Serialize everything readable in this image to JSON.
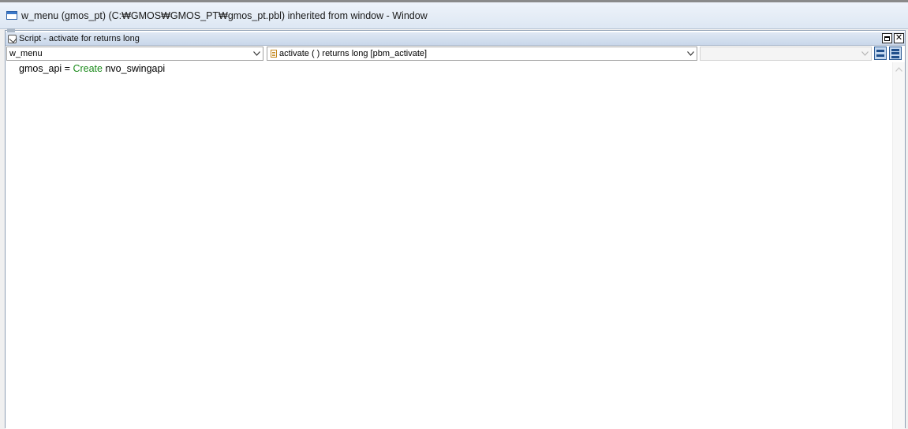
{
  "window": {
    "title": "w_menu (gmos_pt) (C:₩GMOS₩GMOS_PT₩gmos_pt.pbl) inherited from window - Window"
  },
  "script_panel": {
    "title": "Script - activate for  returns long",
    "object_combo": "w_menu",
    "event_combo": "activate ( )  returns long [pbm_activate]",
    "ancestor_combo": "",
    "buttons": {
      "maximize": "□",
      "close": "✕"
    }
  },
  "editor": {
    "lines": [
      {
        "pre": "gmos_api = ",
        "keyword": "Create",
        "post": " nvo_swingapi"
      }
    ]
  },
  "colors": {
    "keyword": "#1a8a1a",
    "title_bar": "#dde7f3",
    "script_bar": "#c9d7ea"
  },
  "icons": [
    "window-icon",
    "script-icon",
    "event-icon",
    "chevron-down-icon",
    "chevron-up-icon",
    "split-view-icon"
  ]
}
